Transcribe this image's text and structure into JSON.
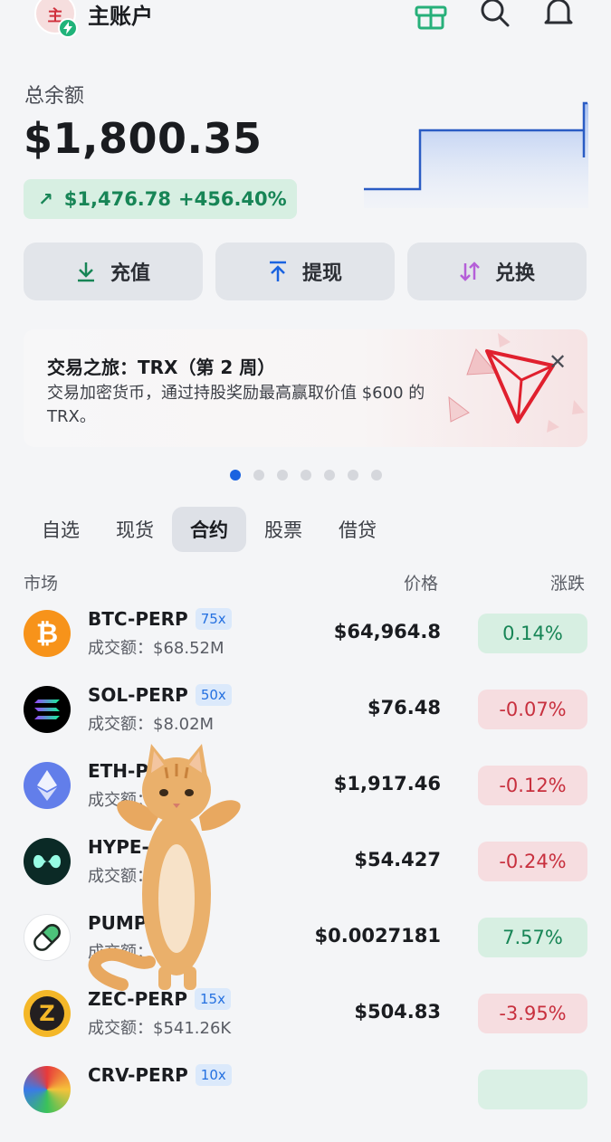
{
  "header": {
    "account_name": "主账户",
    "avatar_text": "主"
  },
  "balance": {
    "label": "总余额",
    "amount": "$1,800.35",
    "pnl_amount": "$1,476.78",
    "pnl_percent": "+456.40%"
  },
  "actions": [
    {
      "label": "充值",
      "icon": "download-icon"
    },
    {
      "label": "提现",
      "icon": "upload-icon"
    },
    {
      "label": "兑换",
      "icon": "swap-icon"
    }
  ],
  "banner": {
    "title": "交易之旅：TRX（第 2 周）",
    "description": "交易加密货币，通过持股奖励最高赢取价值 $600 的 TRX。"
  },
  "carousel": {
    "count": 7,
    "active_index": 0
  },
  "tabs": [
    "自选",
    "现货",
    "合约",
    "股票",
    "借贷"
  ],
  "active_tab": "合约",
  "columns": {
    "market": "市场",
    "price": "价格",
    "change": "涨跌"
  },
  "markets": [
    {
      "symbol": "BTC-PERP",
      "leverage": "75x",
      "volume": "成交额：$68.52M",
      "price": "$64,964.8",
      "change": "0.14%",
      "direction": "up",
      "icon": "bitcoin-icon"
    },
    {
      "symbol": "SOL-PERP",
      "leverage": "50x",
      "volume": "成交额：$8.02M",
      "price": "$76.48",
      "change": "-0.07%",
      "direction": "down",
      "icon": "solana-icon"
    },
    {
      "symbol": "ETH-P",
      "leverage": "",
      "volume": "成交额：",
      "price": "$1,917.46",
      "change": "-0.12%",
      "direction": "down",
      "icon": "ethereum-icon"
    },
    {
      "symbol": "HYPE-",
      "leverage": "",
      "volume": "成交额：",
      "price": "$54.427",
      "change": "-0.24%",
      "direction": "down",
      "icon": "hyperliquid-icon"
    },
    {
      "symbol": "PUMP-",
      "leverage": "",
      "volume": "成交额：",
      "price": "$0.0027181",
      "change": "7.57%",
      "direction": "up",
      "icon": "pill-icon"
    },
    {
      "symbol": "ZEC-PERP",
      "leverage": "15x",
      "volume": "成交额：$541.26K",
      "price": "$504.83",
      "change": "-3.95%",
      "direction": "down",
      "icon": "zcash-icon"
    },
    {
      "symbol": "CRV-PERP",
      "leverage": "10x",
      "volume": "",
      "price": "",
      "change": "",
      "direction": "up",
      "icon": "curve-icon"
    }
  ],
  "colors": {
    "up": "#178556",
    "up_bg": "#d7efe2",
    "down": "#c8303e",
    "down_bg": "#f6dde0",
    "accent": "#1a63e0"
  }
}
